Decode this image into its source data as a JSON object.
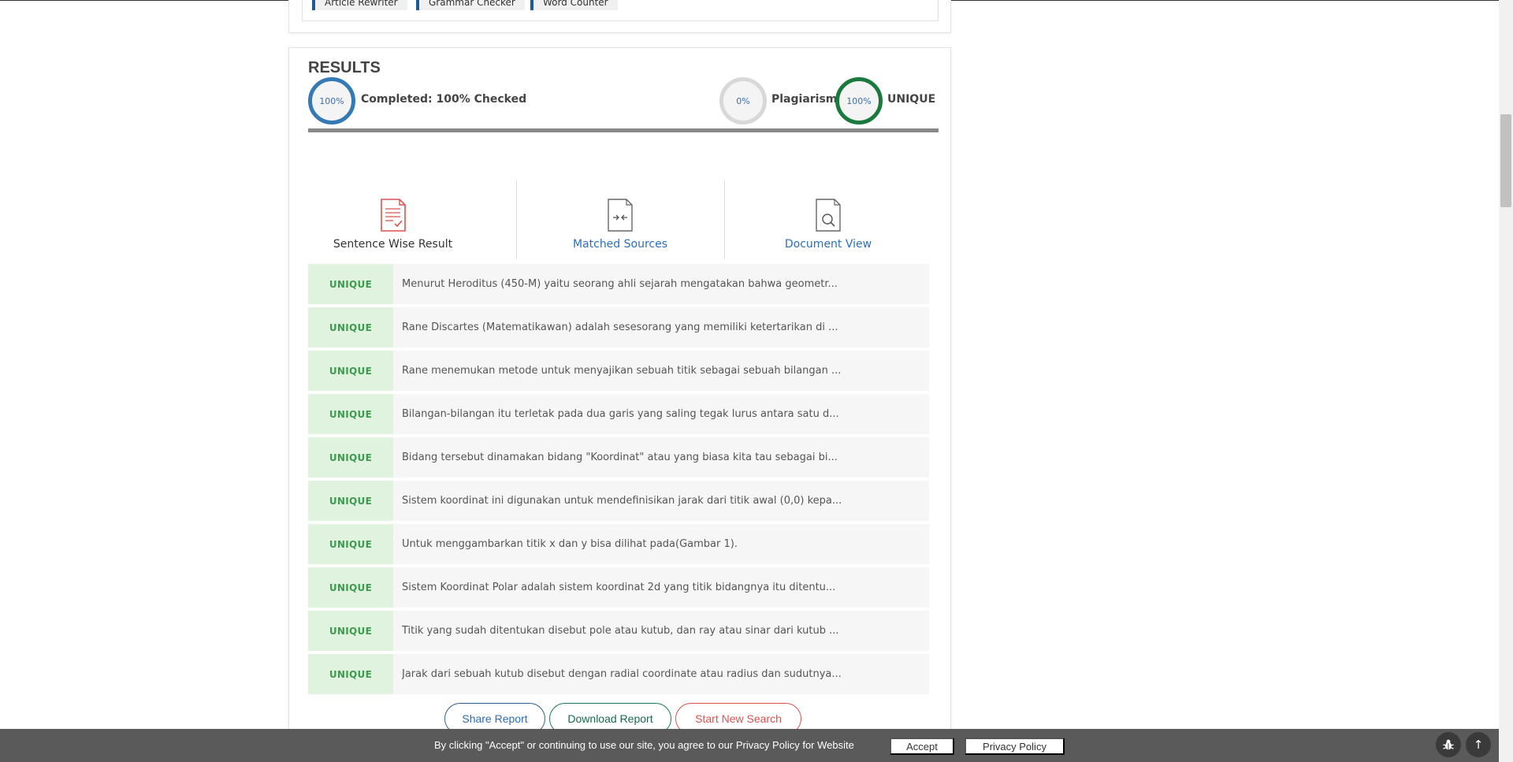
{
  "tools": {
    "links": [
      "Article Rewriter",
      "Grammar Checker",
      "Word Counter"
    ]
  },
  "results": {
    "title": "RESULTS",
    "completed": {
      "ring": "100%",
      "label": "Completed: 100% Checked",
      "progress": 1.0
    },
    "plagiarism": {
      "ring": "0%",
      "label": "Plagiarism"
    },
    "unique": {
      "ring": "100%",
      "label": "UNIQUE"
    }
  },
  "tabs": [
    {
      "label": "Sentence Wise Result",
      "icon": "document-check-icon"
    },
    {
      "label": "Matched Sources",
      "icon": "document-compare-icon"
    },
    {
      "label": "Document View",
      "icon": "document-search-icon"
    }
  ],
  "rows": [
    {
      "status": "UNIQUE",
      "text": "Menurut Heroditus (450-M) yaitu seorang ahli sejarah mengatakan bahwa geometr..."
    },
    {
      "status": "UNIQUE",
      "text": "Rane Discartes (Matematikawan) adalah sesesorang yang memiliki ketertarikan di ..."
    },
    {
      "status": "UNIQUE",
      "text": "Rane menemukan metode untuk menyajikan sebuah titik sebagai sebuah bilangan ..."
    },
    {
      "status": "UNIQUE",
      "text": "Bilangan-bilangan itu terletak pada dua garis yang saling tegak lurus antara satu d..."
    },
    {
      "status": "UNIQUE",
      "text": "Bidang tersebut dinamakan bidang \"Koordinat\" atau yang biasa kita tau sebagai bi..."
    },
    {
      "status": "UNIQUE",
      "text": "Sistem koordinat ini digunakan untuk mendefinisikan jarak dari titik awal (0,0) kepa..."
    },
    {
      "status": "UNIQUE",
      "text": "Untuk menggambarkan titik x dan y bisa dilihat pada(Gambar 1)."
    },
    {
      "status": "UNIQUE",
      "text": "Sistem Koordinat Polar adalah sistem koordinat 2d yang titik bidangnya itu ditentu..."
    },
    {
      "status": "UNIQUE",
      "text": "Titik yang sudah ditentukan disebut pole atau kutub, dan ray atau sinar dari kutub ..."
    },
    {
      "status": "UNIQUE",
      "text": "Jarak dari sebuah kutub disebut dengan radial coordinate atau radius dan sudutnya..."
    }
  ],
  "actions": {
    "share": "Share Report",
    "download": "Download Report",
    "new_search": "Start New Search"
  },
  "cookie": {
    "text": "By clicking \"Accept\" or continuing to use our site, you agree to our Privacy Policy for Website",
    "accept": "Accept",
    "privacy": "Privacy Policy"
  },
  "floating": {
    "bug_icon": "bug-icon",
    "top_icon": "arrow-up-icon",
    "top_glyph": "↑"
  },
  "colors": {
    "accent_blue": "#337ab7",
    "unique_green": "#1a7a3e",
    "status_bg": "#dff3df",
    "status_text": "#3d9a4f",
    "danger": "#d9534f"
  }
}
